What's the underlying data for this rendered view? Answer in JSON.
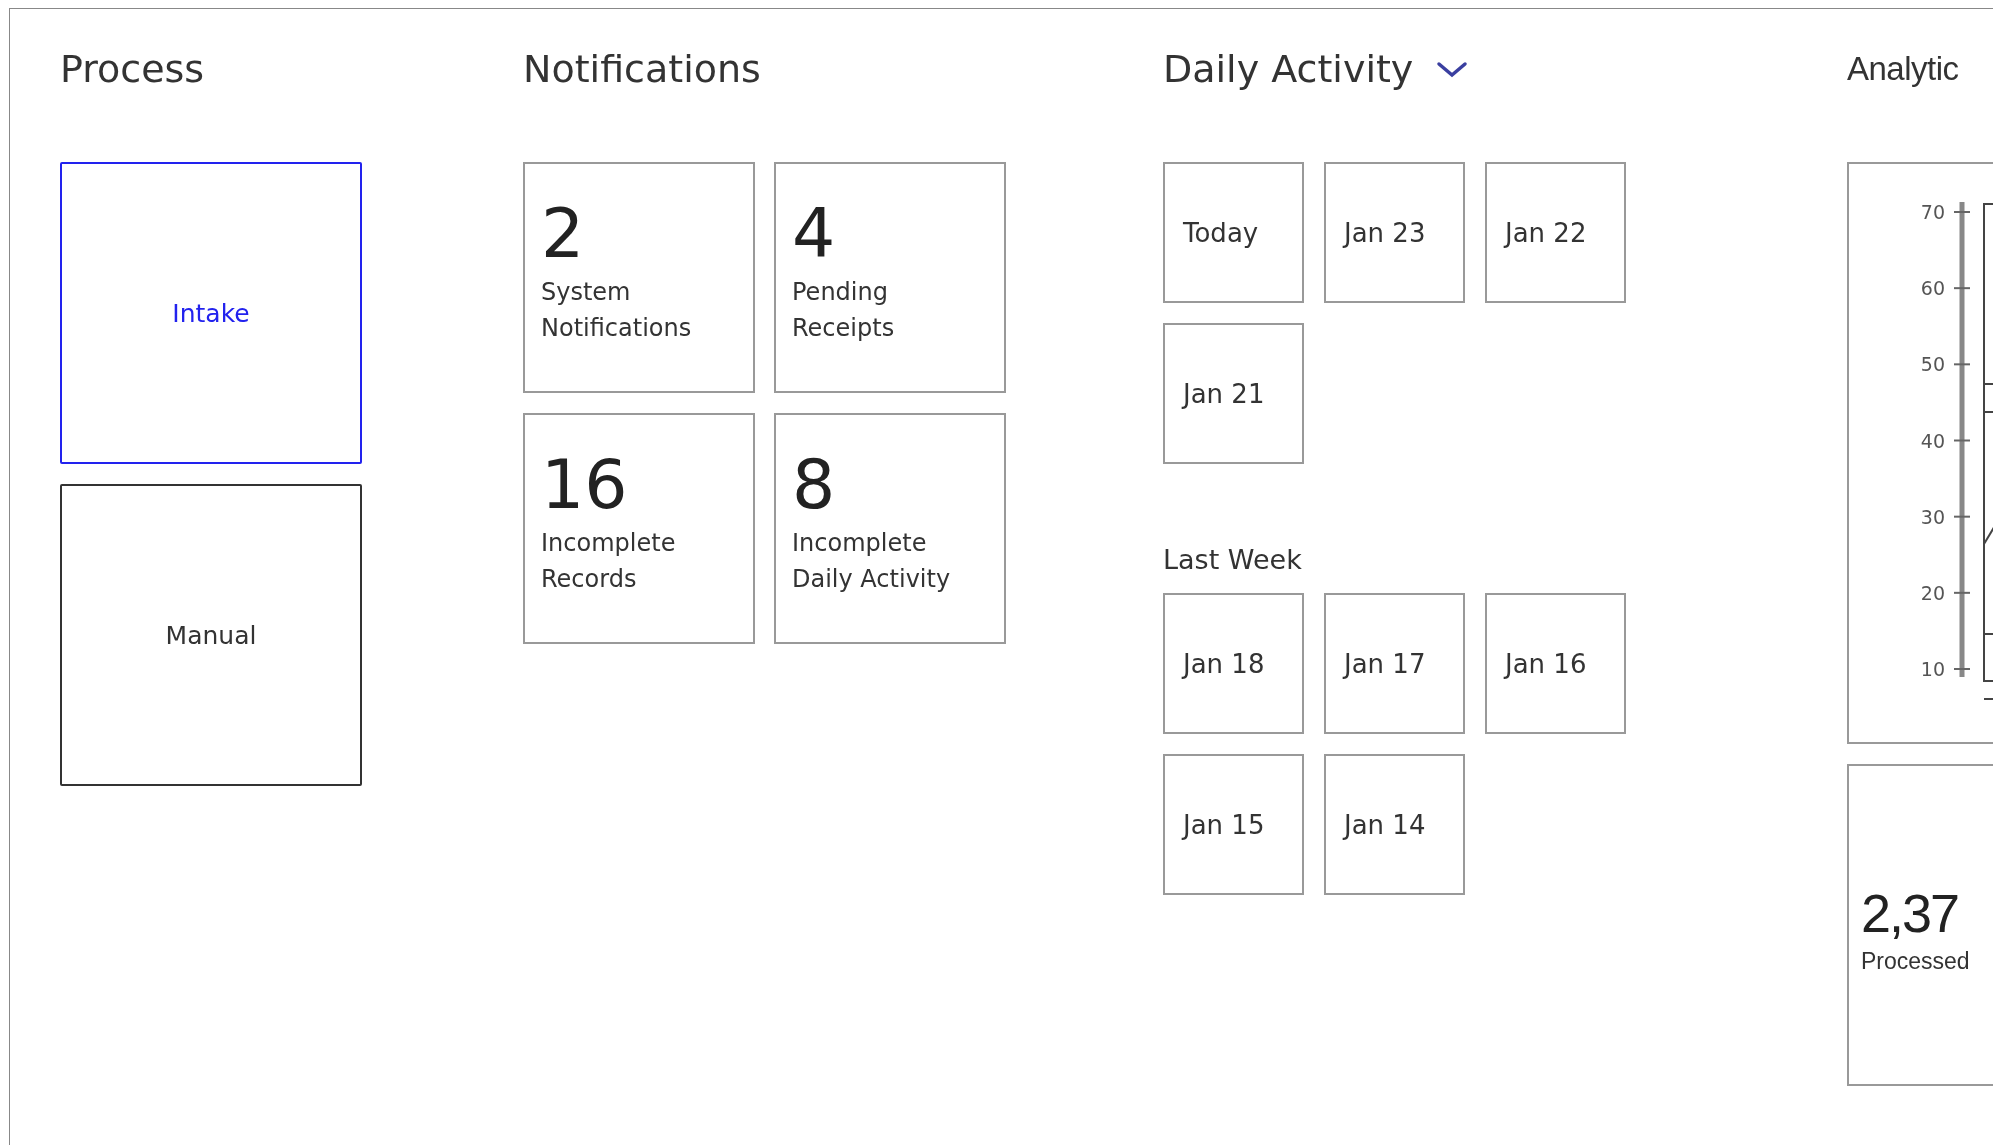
{
  "process": {
    "title": "Process",
    "items": [
      {
        "label": "Intake",
        "selected": true
      },
      {
        "label": "Manual",
        "selected": false
      }
    ]
  },
  "notifications": {
    "title": "Notifications",
    "cards": [
      {
        "count": "2",
        "label": "System Notifications"
      },
      {
        "count": "4",
        "label": "Pending Receipts"
      },
      {
        "count": "16",
        "label": "Incomplete Records"
      },
      {
        "count": "8",
        "label": "Incomplete Daily Activity"
      }
    ]
  },
  "daily_activity": {
    "title": "Daily Activity",
    "expanded": true,
    "recent": [
      "Today",
      "Jan 23",
      "Jan 22",
      "Jan 21"
    ],
    "last_week_label": "Last Week",
    "last_week": [
      "Jan 18",
      "Jan 17",
      "Jan 16",
      "Jan 15",
      "Jan 14"
    ]
  },
  "analytics": {
    "title": "Analytic",
    "y_ticks": [
      "70",
      "60",
      "50",
      "40",
      "30",
      "20",
      "10"
    ],
    "stat": {
      "value": "2,37",
      "label": "Processed"
    }
  }
}
